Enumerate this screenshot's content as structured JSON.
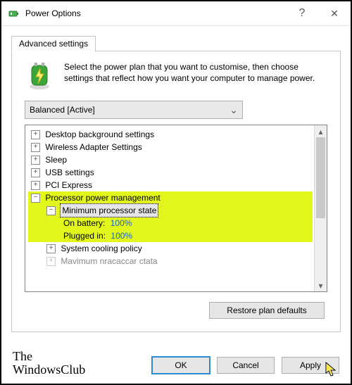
{
  "window": {
    "title": "Power Options"
  },
  "tab": {
    "label": "Advanced settings"
  },
  "intro": "Select the power plan that you want to customise, then choose settings that reflect how you want your computer to manage power.",
  "combo": {
    "value": "Balanced [Active]"
  },
  "tree": {
    "items": [
      "Desktop background settings",
      "Wireless Adapter Settings",
      "Sleep",
      "USB settings",
      "PCI Express"
    ],
    "processor": {
      "label": "Processor power management",
      "minState": {
        "label": "Minimum processor state",
        "battery": {
          "label": "On battery:",
          "value": "100%"
        },
        "plugged": {
          "label": "Plugged in:",
          "value": "100%"
        }
      },
      "cooling": "System cooling policy",
      "maxTrunc": "Mavimum nracaccar ctata"
    }
  },
  "icons": {
    "help": "?",
    "close": "✕",
    "plus": "+",
    "minus": "−",
    "chevDown": "⌄",
    "arrUp": "▴",
    "arrDown": "▾"
  },
  "buttons": {
    "restore": "Restore plan defaults",
    "ok": "OK",
    "cancel": "Cancel",
    "apply": "Apply"
  },
  "brand": {
    "l1": "The",
    "l2": "WindowsClub"
  }
}
